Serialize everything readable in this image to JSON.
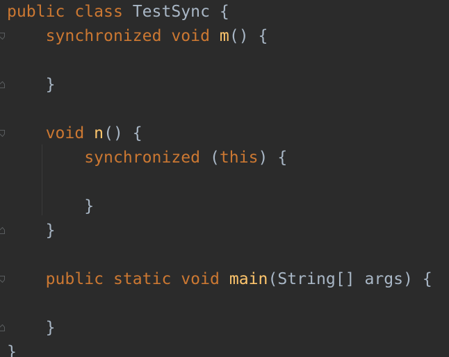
{
  "editor": {
    "lines": [
      {
        "indent": "",
        "tokens": [
          {
            "t": "public ",
            "c": "kw"
          },
          {
            "t": "class ",
            "c": "kw"
          },
          {
            "t": "TestSync ",
            "c": "plain"
          },
          {
            "t": "{",
            "c": "plain"
          }
        ]
      },
      {
        "indent": "    ",
        "tokens": [
          {
            "t": "synchronized ",
            "c": "kw"
          },
          {
            "t": "void ",
            "c": "kw"
          },
          {
            "t": "m",
            "c": "fn"
          },
          {
            "t": "() {",
            "c": "plain"
          }
        ]
      },
      {
        "indent": "",
        "tokens": []
      },
      {
        "indent": "    ",
        "tokens": [
          {
            "t": "}",
            "c": "plain"
          }
        ]
      },
      {
        "indent": "",
        "tokens": []
      },
      {
        "indent": "    ",
        "tokens": [
          {
            "t": "void ",
            "c": "kw"
          },
          {
            "t": "n",
            "c": "fn"
          },
          {
            "t": "() {",
            "c": "plain"
          }
        ]
      },
      {
        "indent": "        ",
        "tokens": [
          {
            "t": "synchronized ",
            "c": "kw"
          },
          {
            "t": "(",
            "c": "plain"
          },
          {
            "t": "this",
            "c": "kw"
          },
          {
            "t": ") {",
            "c": "plain"
          }
        ]
      },
      {
        "indent": "",
        "tokens": []
      },
      {
        "indent": "        ",
        "tokens": [
          {
            "t": "}",
            "c": "plain"
          }
        ]
      },
      {
        "indent": "    ",
        "tokens": [
          {
            "t": "}",
            "c": "plain"
          }
        ]
      },
      {
        "indent": "",
        "tokens": []
      },
      {
        "indent": "    ",
        "tokens": [
          {
            "t": "public ",
            "c": "kw"
          },
          {
            "t": "static ",
            "c": "kw"
          },
          {
            "t": "void ",
            "c": "kw"
          },
          {
            "t": "main",
            "c": "fn"
          },
          {
            "t": "(String[] args) {",
            "c": "plain"
          }
        ]
      },
      {
        "indent": "",
        "tokens": []
      },
      {
        "indent": "    ",
        "tokens": [
          {
            "t": "}",
            "c": "plain"
          }
        ]
      },
      {
        "indent": "",
        "tokens": [
          {
            "t": "}",
            "c": "plain"
          }
        ]
      }
    ],
    "fold_markers": [
      {
        "line": 1,
        "kind": "open"
      },
      {
        "line": 3,
        "kind": "close"
      },
      {
        "line": 5,
        "kind": "open"
      },
      {
        "line": 9,
        "kind": "close"
      },
      {
        "line": 11,
        "kind": "open"
      },
      {
        "line": 13,
        "kind": "close"
      }
    ],
    "colors": {
      "background": "#2b2b2b",
      "keyword": "#cc7832",
      "function": "#ffc66d",
      "plain": "#a9b7c6",
      "fold_marker": "#5a5d5f",
      "indent_guide": "#3b3b3b"
    },
    "icons": {
      "fold_open": "fold-open-icon",
      "fold_close": "fold-close-icon"
    }
  }
}
